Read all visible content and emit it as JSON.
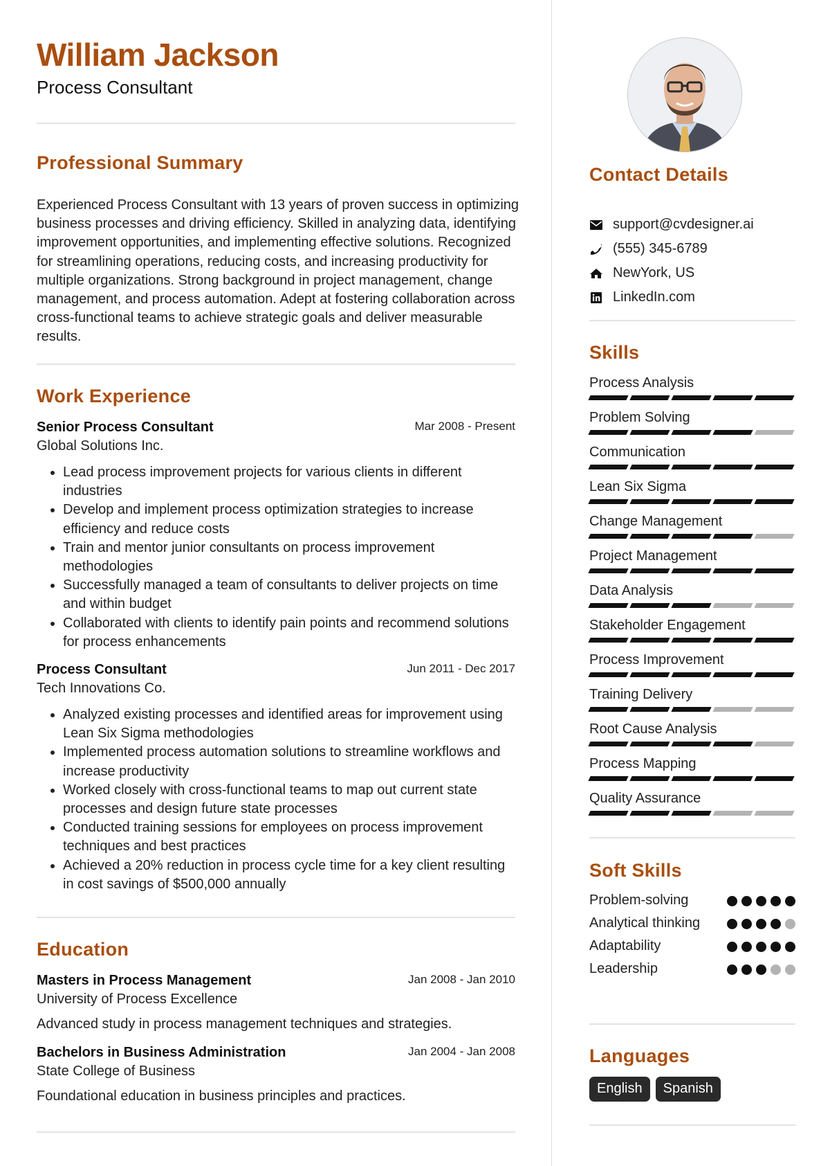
{
  "header": {
    "name": "William Jackson",
    "title": "Process Consultant"
  },
  "summary": {
    "heading": "Professional Summary",
    "text": "Experienced Process Consultant with 13 years of proven success in optimizing business processes and driving efficiency. Skilled in analyzing data, identifying improvement opportunities, and implementing effective solutions. Recognized for streamlining operations, reducing costs, and increasing productivity for multiple organizations. Strong background in project management, change management, and process automation. Adept at fostering collaboration across cross-functional teams to achieve strategic goals and deliver measurable results."
  },
  "experience": {
    "heading": "Work Experience",
    "jobs": [
      {
        "role": "Senior Process Consultant",
        "dates": "Mar 2008 - Present",
        "company": "Global Solutions Inc.",
        "bullets": [
          "Lead process improvement projects for various clients in different industries",
          "Develop and implement process optimization strategies to increase efficiency and reduce costs",
          "Train and mentor junior consultants on process improvement methodologies",
          "Successfully managed a team of consultants to deliver projects on time and within budget",
          "Collaborated with clients to identify pain points and recommend solutions for process enhancements"
        ]
      },
      {
        "role": "Process Consultant",
        "dates": "Jun 2011 - Dec 2017",
        "company": "Tech Innovations Co.",
        "bullets": [
          "Analyzed existing processes and identified areas for improvement using Lean Six Sigma methodologies",
          "Implemented process automation solutions to streamline workflows and increase productivity",
          "Worked closely with cross-functional teams to map out current state processes and design future state processes",
          "Conducted training sessions for employees on process improvement techniques and best practices",
          "Achieved a 20% reduction in process cycle time for a key client resulting in cost savings of $500,000 annually"
        ]
      }
    ]
  },
  "education": {
    "heading": "Education",
    "items": [
      {
        "degree": "Masters in Process Management",
        "dates": "Jan 2008 - Jan 2010",
        "school": "University of Process Excellence",
        "description": "Advanced study in process management techniques and strategies."
      },
      {
        "degree": "Bachelors in Business Administration",
        "dates": "Jan 2004 - Jan 2008",
        "school": "State College of Business",
        "description": "Foundational education in business principles and practices."
      }
    ]
  },
  "contact": {
    "heading": "Contact Details",
    "items": [
      {
        "icon": "envelope-icon",
        "text": "support@cvdesigner.ai"
      },
      {
        "icon": "phone-icon",
        "text": "(555) 345-6789"
      },
      {
        "icon": "home-icon",
        "text": "NewYork, US"
      },
      {
        "icon": "linkedin-icon",
        "text": "LinkedIn.com"
      }
    ]
  },
  "skills": {
    "heading": "Skills",
    "max_level": 5,
    "items": [
      {
        "name": "Process Analysis",
        "level": 5
      },
      {
        "name": "Problem Solving",
        "level": 4
      },
      {
        "name": "Communication",
        "level": 5
      },
      {
        "name": "Lean Six Sigma",
        "level": 5
      },
      {
        "name": "Change Management",
        "level": 4
      },
      {
        "name": "Project Management",
        "level": 5
      },
      {
        "name": "Data Analysis",
        "level": 3
      },
      {
        "name": "Stakeholder Engagement",
        "level": 5
      },
      {
        "name": "Process Improvement",
        "level": 5
      },
      {
        "name": "Training Delivery",
        "level": 3
      },
      {
        "name": "Root Cause Analysis",
        "level": 4
      },
      {
        "name": "Process Mapping",
        "level": 5
      },
      {
        "name": "Quality Assurance",
        "level": 3
      }
    ]
  },
  "soft_skills": {
    "heading": "Soft Skills",
    "max_level": 5,
    "items": [
      {
        "name": "Problem-solving",
        "level": 5
      },
      {
        "name": "Analytical thinking",
        "level": 4
      },
      {
        "name": "Adaptability",
        "level": 5
      },
      {
        "name": "Leadership",
        "level": 3
      }
    ]
  },
  "languages": {
    "heading": "Languages",
    "items": [
      "English",
      "Spanish"
    ]
  },
  "colors": {
    "accent": "#a94e0f",
    "bar_filled": "#111111",
    "bar_empty": "#b3b3b3",
    "tag_bg": "#2a2a2a"
  }
}
